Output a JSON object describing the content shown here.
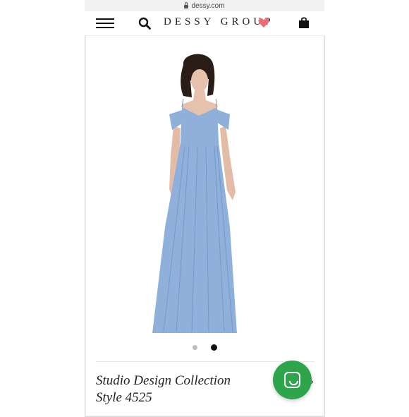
{
  "browser": {
    "url": "dessy.com"
  },
  "header": {
    "brand": "DESSY GROUP"
  },
  "carousel": {
    "total": 2,
    "active_index": 2
  },
  "product": {
    "title_line1": "Studio Design Collection",
    "title_line2": "Style 4525"
  },
  "colors": {
    "accent_heart": "#f06a73",
    "chat_green": "#2ea54b",
    "dress_blue": "#8fb0db"
  },
  "icons": {
    "menu": "hamburger-icon",
    "search": "search-icon",
    "wishlist": "heart-icon",
    "cart": "shopping-bag-icon",
    "chat": "chat-icon"
  }
}
